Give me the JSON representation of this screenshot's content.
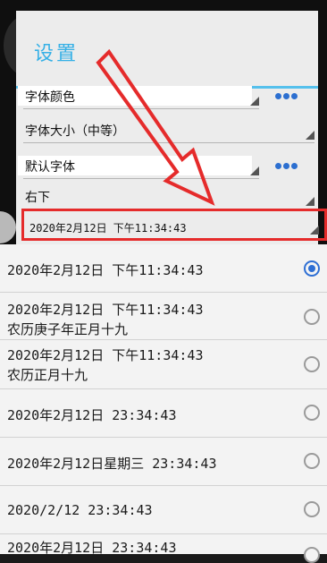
{
  "dialog": {
    "title": "设置",
    "rows": [
      {
        "label": "字体颜色"
      },
      {
        "label": "字体大小（中等）"
      },
      {
        "label": "默认字体"
      },
      {
        "label": "右下"
      }
    ],
    "highlighted_value": "2020年2月12日  下午11:34:43"
  },
  "options": [
    {
      "line1": "2020年2月12日  下午11:34:43",
      "line2": "",
      "selected": true
    },
    {
      "line1": "2020年2月12日  下午11:34:43",
      "line2": "农历庚子年正月十九",
      "selected": false
    },
    {
      "line1": "2020年2月12日  下午11:34:43",
      "line2": "农历正月十九",
      "selected": false
    },
    {
      "line1": "2020年2月12日  23:34:43",
      "line2": "",
      "selected": false
    },
    {
      "line1": "2020年2月12日星期三  23:34:43",
      "line2": "",
      "selected": false
    },
    {
      "line1": "2020/2/12  23:34:43",
      "line2": "",
      "selected": false
    },
    {
      "line1": "2020年2月12日  23:34:43",
      "line2": "",
      "selected": false
    }
  ],
  "icons": {
    "more": "more-dots-icon",
    "dropdown": "dropdown-triangle-icon",
    "annotation": "red-arrow-annotation"
  },
  "colors": {
    "accent": "#35b0e6",
    "highlight": "#e52b2b",
    "radio_selected": "#2e6fd4"
  }
}
